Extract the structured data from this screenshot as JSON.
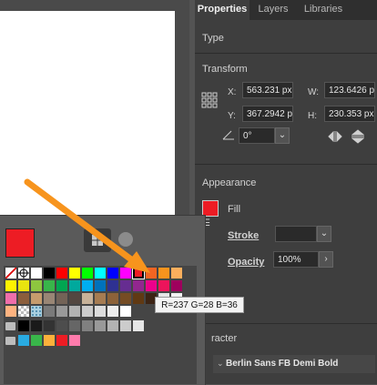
{
  "panel": {
    "tabs": [
      {
        "label": "Properties",
        "active": true
      },
      {
        "label": "Layers",
        "active": false
      },
      {
        "label": "Libraries",
        "active": false
      }
    ],
    "type_title": "Type",
    "transform": {
      "title": "Transform",
      "x_label": "X:",
      "x_value": "563.231 px",
      "w_label": "W:",
      "w_value": "123.6426 p",
      "y_label": "Y:",
      "y_value": "367.2942 p",
      "h_label": "H:",
      "h_value": "230.353 px",
      "angle_value": "0°"
    },
    "appearance": {
      "title": "Appearance",
      "fill_label": "Fill",
      "stroke_label": "Stroke",
      "opacity_label": "Opacity",
      "opacity_value": "100%",
      "fill_color": "#ed1c24"
    },
    "character": {
      "title": "racter",
      "font_name": "Berlin Sans FB Demi Bold"
    }
  },
  "popup": {
    "selected_color": "#ed1c24",
    "tooltip": "R=237 G=28 B=36"
  },
  "colors": {
    "accent_arrow": "#f7941d",
    "highlight_selected": "#ed1c24"
  }
}
